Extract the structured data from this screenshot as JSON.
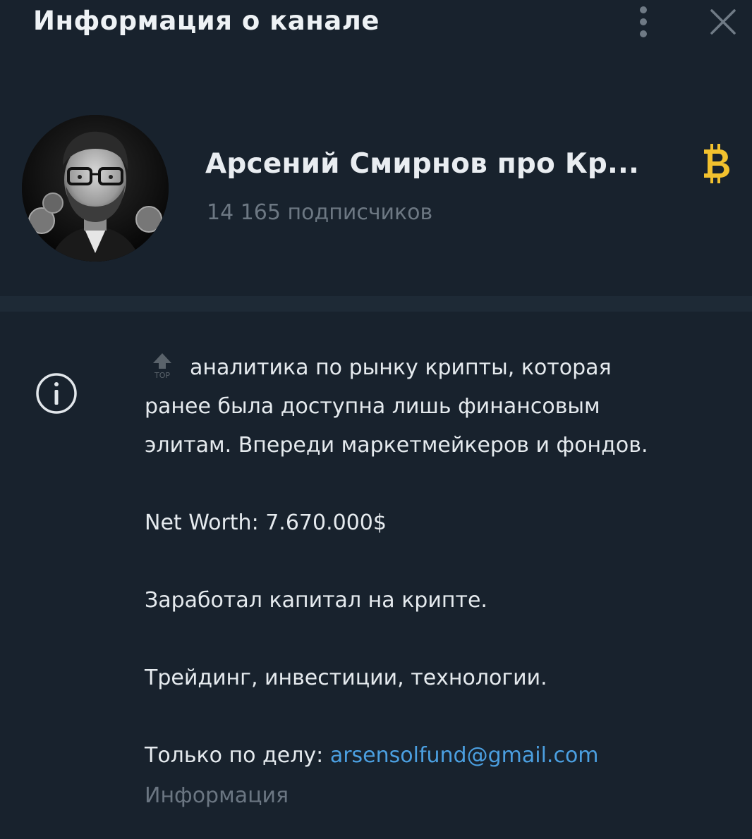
{
  "header": {
    "title": "Информация о канале"
  },
  "channel": {
    "name": "Арсений Смирнов про Кр...",
    "subscribers": "14 165 подписчиков",
    "badge_icon": "bitcoin-icon"
  },
  "info": {
    "line1": "аналитика по рынку крипты, которая",
    "line2": "ранее была доступна лишь финансовым",
    "line3": "элитам. Впереди маркетмейкеров и фондов.",
    "net_worth": "Net Worth: 7.670.000$",
    "earned": "Заработал капитал на крипте.",
    "topics": "Трейдинг, инвестиции, технологии.",
    "contact_prefix": "Только по делу: ",
    "email": "arsensolfund@gmail.com",
    "label": "Информация",
    "top_emoji_text": "TOP"
  },
  "colors": {
    "background": "#18222d",
    "divider": "#1e2a36",
    "link": "#4b9fe0",
    "muted": "#6d7883",
    "bitcoin": "#f2c12e"
  }
}
